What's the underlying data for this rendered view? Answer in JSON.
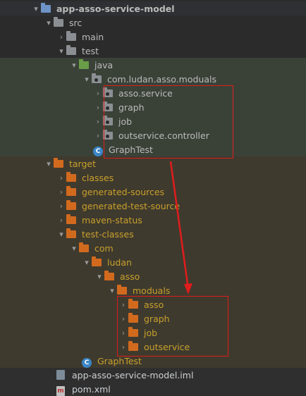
{
  "tree": {
    "root": {
      "label": "app-asso-service-model"
    },
    "src": {
      "label": "src"
    },
    "main": {
      "label": "main"
    },
    "test": {
      "label": "test"
    },
    "java": {
      "label": "java"
    },
    "package": {
      "label": "com.ludan.asso.moduals"
    },
    "src_children": [
      {
        "label": "asso.service"
      },
      {
        "label": "graph"
      },
      {
        "label": "job"
      },
      {
        "label": "outservice.controller"
      }
    ],
    "graphtest_src": {
      "label": "GraphTest"
    },
    "target": {
      "label": "target"
    },
    "target_children": [
      {
        "label": "classes"
      },
      {
        "label": "generated-sources"
      },
      {
        "label": "generated-test-source"
      },
      {
        "label": "maven-status"
      }
    ],
    "test_classes": {
      "label": "test-classes"
    },
    "com": {
      "label": "com"
    },
    "ludan": {
      "label": "ludan"
    },
    "asso": {
      "label": "asso"
    },
    "moduals": {
      "label": "moduals"
    },
    "target_modual_children": [
      {
        "label": "asso"
      },
      {
        "label": "graph"
      },
      {
        "label": "job"
      },
      {
        "label": "outservice"
      }
    ],
    "graphtest_target": {
      "label": "GraphTest"
    },
    "iml": {
      "label": "app-asso-service-model.iml"
    },
    "pom": {
      "label": "pom.xml"
    }
  },
  "colors": {
    "annotation_red": "#e01c1c",
    "folder_orange": "#d26a1e",
    "folder_green": "#6a9d48",
    "label_yellow": "#c8a02b"
  },
  "icons": {
    "expanded": "chevron-down-icon",
    "collapsed": "chevron-right-icon",
    "module": "module-folder-icon",
    "folder": "folder-icon",
    "source_root": "test-source-root-icon",
    "package": "package-icon",
    "java_class": "java-class-icon",
    "excluded": "excluded-folder-icon",
    "iml_file": "iml-file-icon",
    "maven": "maven-pom-icon"
  }
}
